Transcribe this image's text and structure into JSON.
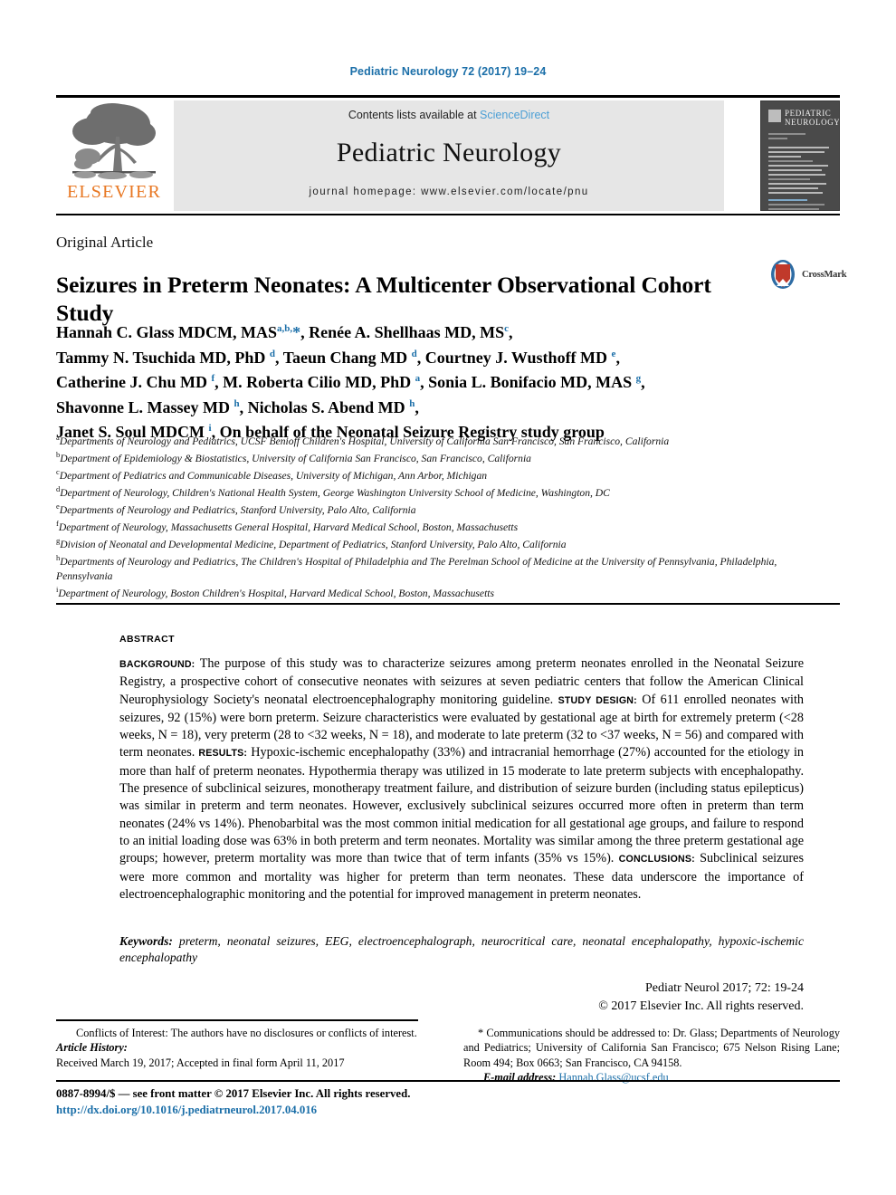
{
  "running_head": "Pediatric Neurology 72 (2017) 19–24",
  "masthead": {
    "publisher_name": "ELSEVIER",
    "contents_prefix": "Contents lists available at ",
    "contents_link": "ScienceDirect",
    "journal_title": "Pediatric Neurology",
    "homepage": "journal homepage: www.elsevier.com/locate/pnu",
    "cover": {
      "line1": "PEDIATRIC",
      "line2": "NEUROLOGY"
    }
  },
  "article": {
    "type": "Original Article",
    "title": "Seizures in Preterm Neonates: A Multicenter Observational Cohort Study",
    "crossmark_label": "CrossMark"
  },
  "authors_html": "Hannah C. Glass MDCM, MAS<sup>a,b,</sup><span class=\"star\">*</span>, Renée A. Shellhaas MD, MS<sup>c</sup>,<br>Tammy N. Tsuchida MD, PhD <sup>d</sup>, Taeun Chang MD <sup>d</sup>, Courtney J. Wusthoff MD <sup>e</sup>,<br>Catherine J. Chu MD <sup>f</sup>, M. Roberta Cilio MD, PhD <sup>a</sup>, Sonia L. Bonifacio MD, MAS <sup>g</sup>,<br>Shavonne L. Massey MD <sup>h</sup>, Nicholas S. Abend MD <sup>h</sup>,<br>Janet S. Soul MDCM <sup>i</sup>, On behalf of the Neonatal Seizure Registry study group",
  "affiliations": [
    {
      "mark": "a",
      "text": "Departments of Neurology and Pediatrics, UCSF Benioff Children's Hospital, University of California San Francisco, San Francisco, California"
    },
    {
      "mark": "b",
      "text": "Department of Epidemiology & Biostatistics, University of California San Francisco, San Francisco, California"
    },
    {
      "mark": "c",
      "text": "Department of Pediatrics and Communicable Diseases, University of Michigan, Ann Arbor, Michigan"
    },
    {
      "mark": "d",
      "text": "Department of Neurology, Children's National Health System, George Washington University School of Medicine, Washington, DC"
    },
    {
      "mark": "e",
      "text": "Departments of Neurology and Pediatrics, Stanford University, Palo Alto, California"
    },
    {
      "mark": "f",
      "text": "Department of Neurology, Massachusetts General Hospital, Harvard Medical School, Boston, Massachusetts"
    },
    {
      "mark": "g",
      "text": "Division of Neonatal and Developmental Medicine, Department of Pediatrics, Stanford University, Palo Alto, California"
    },
    {
      "mark": "h",
      "text": "Departments of Neurology and Pediatrics, The Children's Hospital of Philadelphia and The Perelman School of Medicine at the University of Pennsylvania, Philadelphia, Pennsylvania"
    },
    {
      "mark": "i",
      "text": "Department of Neurology, Boston Children's Hospital, Harvard Medical School, Boston, Massachusetts"
    }
  ],
  "abstract": {
    "label": "ABSTRACT",
    "sections": [
      {
        "heading": "BACKGROUND:",
        "text": " The purpose of this study was to characterize seizures among preterm neonates enrolled in the Neonatal Seizure Registry, a prospective cohort of consecutive neonates with seizures at seven pediatric centers that follow the American Clinical Neurophysiology Society's neonatal electroencephalography monitoring guideline. "
      },
      {
        "heading": "STUDY DESIGN:",
        "text": " Of 611 enrolled neonates with seizures, 92 (15%) were born preterm. Seizure characteristics were evaluated by gestational age at birth for extremely preterm (<28 weeks, N = 18), very preterm (28 to <32 weeks, N = 18), and moderate to late preterm (32 to <37 weeks, N = 56) and compared with term neonates. "
      },
      {
        "heading": "RESULTS:",
        "text": " Hypoxic-ischemic encephalopathy (33%) and intracranial hemorrhage (27%) accounted for the etiology in more than half of preterm neonates. Hypothermia therapy was utilized in 15 moderate to late preterm subjects with encephalopathy. The presence of subclinical seizures, monotherapy treatment failure, and distribution of seizure burden (including status epilepticus) was similar in preterm and term neonates. However, exclusively subclinical seizures occurred more often in preterm than term neonates (24% vs 14%). Phenobarbital was the most common initial medication for all gestational age groups, and failure to respond to an initial loading dose was 63% in both preterm and term neonates. Mortality was similar among the three preterm gestational age groups; however, preterm mortality was more than twice that of term infants (35% vs 15%). "
      },
      {
        "heading": "CONCLUSIONS:",
        "text": " Subclinical seizures were more common and mortality was higher for preterm than term neonates. These data underscore the importance of electroencephalographic monitoring and the potential for improved management in preterm neonates."
      }
    ],
    "keywords_label": "Keywords:",
    "keywords": " preterm, neonatal seizures, EEG, electroencephalograph, neurocritical care, neonatal encephalopathy, hypoxic-ischemic encephalopathy",
    "citation": "Pediatr Neurol 2017; 72: 19-24",
    "copyright": "© 2017 Elsevier Inc. All rights reserved."
  },
  "footnotes": {
    "conflicts": "Conflicts of Interest: The authors have no disclosures or conflicts of interest.",
    "history_label": "Article History:",
    "history": "Received March 19, 2017; Accepted in final form April 11, 2017",
    "correspondence": "* Communications should be addressed to: Dr. Glass; Departments of Neurology and Pediatrics; University of California San Francisco; 675 Nelson Rising Lane; Room 494; Box 0663; San Francisco, CA 94158.",
    "email_label": "E-mail address:",
    "email": "Hannah.Glass@ucsf.edu"
  },
  "footer": {
    "issn": "0887-8994/$ — see front matter © 2017 Elsevier Inc. All rights reserved.",
    "doi": "http://dx.doi.org/10.1016/j.pediatrneurol.2017.04.016"
  },
  "colors": {
    "link_blue": "#1a6ea8",
    "sciencedirect_blue": "#4b9fd5",
    "elsevier_orange": "#e87722",
    "banner_gray": "#e6e6e6"
  }
}
